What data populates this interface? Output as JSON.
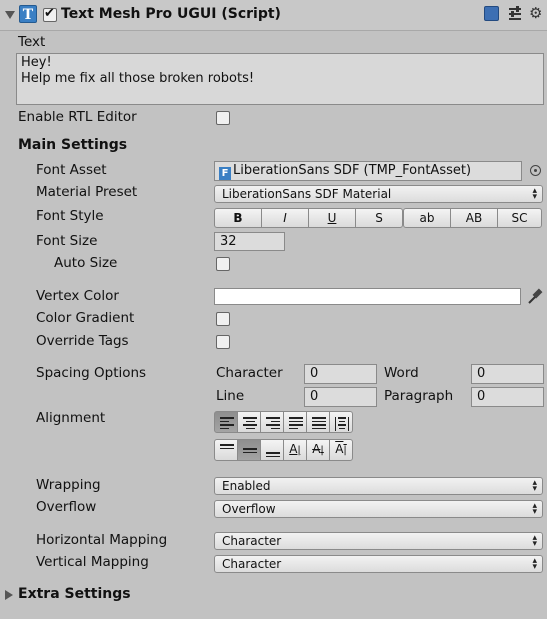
{
  "component": {
    "title": "Text Mesh Pro UGUI (Script)",
    "icon": "textmeshpro-t-icon",
    "enabled": true,
    "header_icons": [
      "help-book-icon",
      "preset-sliders-icon",
      "gear-menu-icon"
    ]
  },
  "text": {
    "label": "Text",
    "line1": "Hey!",
    "line2": "Help me fix all those broken robots!"
  },
  "rtl": {
    "label": "Enable RTL Editor",
    "checked": false
  },
  "main_settings": {
    "heading": "Main Settings",
    "font_asset": {
      "label": "Font Asset",
      "value": "LiberationSans SDF (TMP_FontAsset)"
    },
    "material_preset": {
      "label": "Material Preset",
      "value": "LiberationSans SDF Material"
    },
    "font_style": {
      "label": "Font Style",
      "group1": [
        "B",
        "I",
        "U",
        "S"
      ],
      "group2": [
        "ab",
        "AB",
        "SC"
      ]
    },
    "font_size": {
      "label": "Font Size",
      "value": "32"
    },
    "auto_size": {
      "label": "Auto Size",
      "checked": false
    },
    "vertex_color": {
      "label": "Vertex Color",
      "value": "#ffffff"
    },
    "color_gradient": {
      "label": "Color Gradient",
      "checked": false
    },
    "override_tags": {
      "label": "Override Tags",
      "checked": false
    },
    "spacing": {
      "label": "Spacing Options",
      "character_label": "Character",
      "character_value": "0",
      "word_label": "Word",
      "word_value": "0",
      "line_label": "Line",
      "line_value": "0",
      "paragraph_label": "Paragraph",
      "paragraph_value": "0"
    },
    "alignment": {
      "label": "Alignment",
      "horizontal": [
        "align-left-icon",
        "align-center-icon",
        "align-right-icon",
        "align-justified-icon",
        "align-flush-icon",
        "align-geometry-center-icon"
      ],
      "horizontal_selected": 0,
      "vertical": [
        "align-top-icon",
        "align-middle-icon",
        "align-bottom-icon",
        "align-baseline-icon",
        "align-midline-icon",
        "align-capline-icon"
      ],
      "vertical_selected": 1
    },
    "wrapping": {
      "label": "Wrapping",
      "value": "Enabled"
    },
    "overflow": {
      "label": "Overflow",
      "value": "Overflow"
    },
    "horizontal_mapping": {
      "label": "Horizontal Mapping",
      "value": "Character"
    },
    "vertical_mapping": {
      "label": "Vertical Mapping",
      "value": "Character"
    }
  },
  "extra_settings": {
    "heading": "Extra Settings",
    "expanded": false
  }
}
